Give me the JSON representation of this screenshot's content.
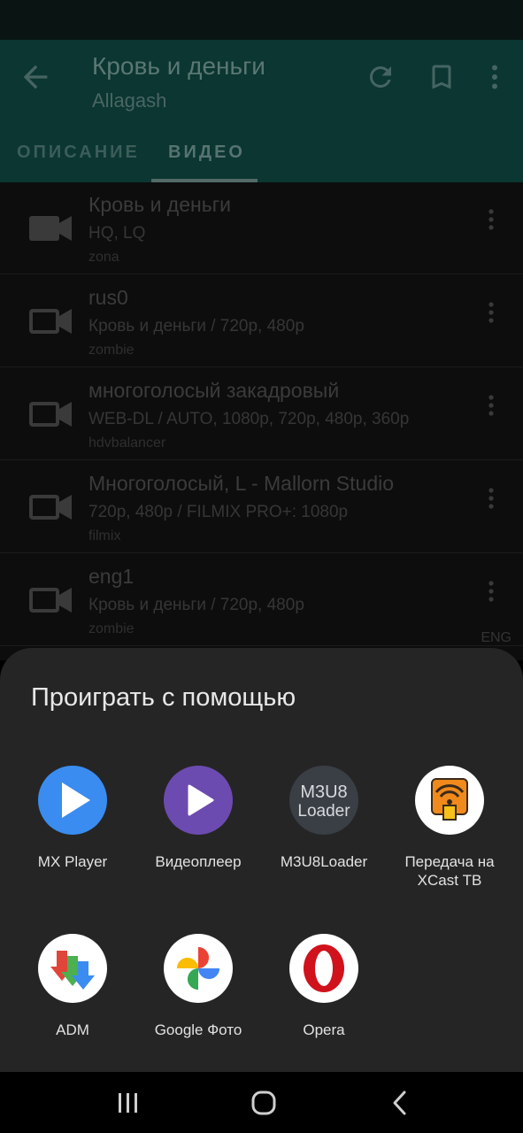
{
  "toolbar": {
    "title": "Кровь и деньги",
    "subtitle": "Allagash",
    "tabs": [
      {
        "label": "ОПИСАНИЕ"
      },
      {
        "label": "ВИДЕО"
      }
    ]
  },
  "videos": [
    {
      "title": "Кровь и деньги",
      "details": "HQ, LQ",
      "source": "zona",
      "badge": ""
    },
    {
      "title": "rus0",
      "details": "Кровь и деньги / 720p, 480p",
      "source": "zombie",
      "badge": ""
    },
    {
      "title": "многоголосый закадровый",
      "details": "WEB-DL / AUTO, 1080p, 720p, 480p, 360p",
      "source": "hdvbalancer",
      "badge": ""
    },
    {
      "title": "Многоголосый, L - Mallorn Studio",
      "details": "720p, 480p / FILMIX PRO+: 1080p",
      "source": "filmix",
      "badge": ""
    },
    {
      "title": "eng1",
      "details": "Кровь и деньги / 720p, 480p",
      "source": "zombie",
      "badge": "ENG"
    }
  ],
  "sheet": {
    "title": "Проиграть с помощью",
    "apps": [
      {
        "label": "MX Player",
        "icon": "mx-player-icon"
      },
      {
        "label": "Видеоплеер",
        "icon": "video-player-icon"
      },
      {
        "label": "M3U8Loader",
        "icon": "m3u8-loader-icon",
        "icon_text_1": "M3U8",
        "icon_text_2": "Loader"
      },
      {
        "label": "Передача на XCast ТВ",
        "icon": "xcast-icon"
      },
      {
        "label": "ADM",
        "icon": "adm-icon"
      },
      {
        "label": "Google Фото",
        "icon": "google-photos-icon"
      },
      {
        "label": "Opera",
        "icon": "opera-icon"
      }
    ]
  },
  "colors": {
    "appbar": "#0b3631",
    "sheet_background": "#252525",
    "mx_blue": "#3a8cf0",
    "video_purple": "#6c4bb0",
    "opera_red": "#d0121c",
    "xcast_orange": "#f08a1c"
  }
}
